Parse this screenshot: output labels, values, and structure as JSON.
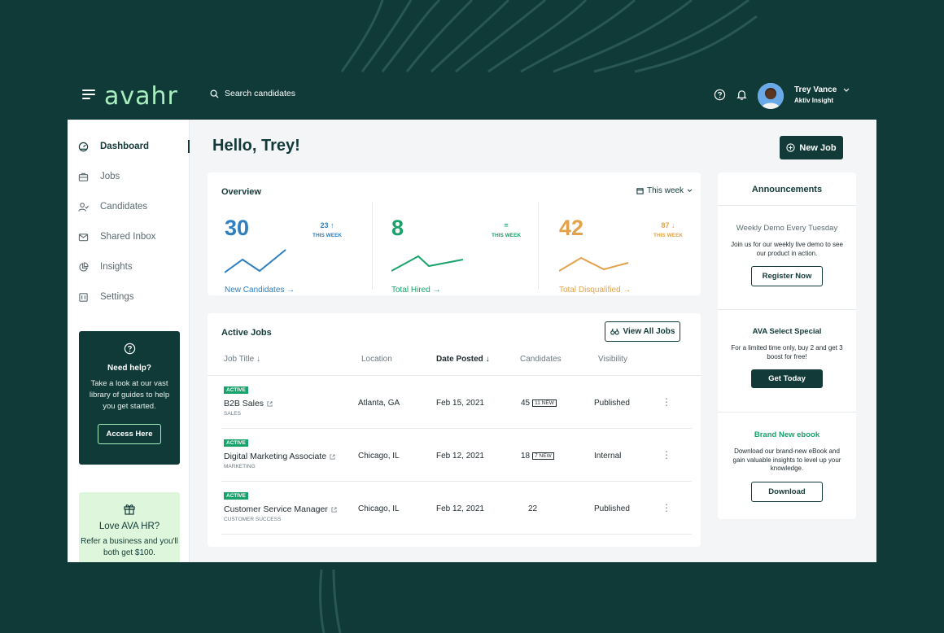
{
  "header": {
    "logo": "avahr",
    "search_placeholder": "Search candidates",
    "user_name": "Trey Vance",
    "user_company": "Aktiv Insight"
  },
  "sidebar": {
    "items": [
      {
        "label": "Dashboard",
        "icon": "gauge-icon",
        "active": true
      },
      {
        "label": "Jobs",
        "icon": "briefcase-icon",
        "active": false
      },
      {
        "label": "Candidates",
        "icon": "user-check-icon",
        "active": false
      },
      {
        "label": "Shared Inbox",
        "icon": "mail-icon",
        "active": false
      },
      {
        "label": "Insights",
        "icon": "pie-chart-icon",
        "active": false
      },
      {
        "label": "Settings",
        "icon": "settings-icon",
        "active": false
      }
    ],
    "help": {
      "title": "Need help?",
      "text": "Take a look at our vast library of guides to help you get started.",
      "button": "Access Here"
    },
    "love": {
      "title": "Love AVA HR?",
      "text": "Refer a business and you'll both get $100."
    }
  },
  "main": {
    "greeting": "Hello, Trey!",
    "new_job": "New Job"
  },
  "overview": {
    "title": "Overview",
    "filter": "This week",
    "stats": [
      {
        "value": "30",
        "delta": "23 ↑",
        "period": "THIS WEEK",
        "label": "New Candidates →",
        "color": "#2d7fc1"
      },
      {
        "value": "8",
        "delta": "=",
        "period": "THIS WEEK",
        "label": "Total Hired →",
        "color": "#19a36b"
      },
      {
        "value": "42",
        "delta": "87 ↓",
        "period": "THIS WEEK",
        "label": "Total Disqualified →",
        "color": "#e3a24a"
      }
    ]
  },
  "jobs": {
    "title": "Active Jobs",
    "view_all": "View All Jobs",
    "columns": [
      "Job Title ↓",
      "Location",
      "Date Posted ↓",
      "Candidates",
      "Visibility"
    ],
    "rows": [
      {
        "status": "ACTIVE",
        "title": "B2B Sales",
        "dept": "SALES",
        "location": "Atlanta, GA",
        "date": "Feb 15, 2021",
        "candidates": "45",
        "new": "11 NEW",
        "visibility": "Published"
      },
      {
        "status": "ACTIVE",
        "title": "Digital Marketing Associate",
        "dept": "MARKETING",
        "location": "Chicago, IL",
        "date": "Feb 12, 2021",
        "candidates": "18",
        "new": "7 NEW",
        "visibility": "Internal"
      },
      {
        "status": "ACTIVE",
        "title": "Customer Service Manager",
        "dept": "CUSTOMER SUCCESS",
        "location": "Chicago, IL",
        "date": "Feb 12, 2021",
        "candidates": "22",
        "new": "",
        "visibility": "Published"
      }
    ]
  },
  "announcements": {
    "title": "Announcements",
    "items": [
      {
        "heading": "Weekly Demo Every Tuesday",
        "text": "Join us for our weekly live demo to see our product in action.",
        "button": "Register Now",
        "heading_color": "#5c6b70"
      },
      {
        "heading": "AVA Select Special",
        "text": "For a limited time only, buy 2 and get 3 boost for free!",
        "button": "Get Today",
        "heading_color": "#123a38"
      },
      {
        "heading": "Brand New ebook",
        "text": "Download our brand-new eBook and gain valuable insights to level up your knowledge.",
        "button": "Download",
        "heading_color": "#19a36b"
      }
    ]
  },
  "colors": {
    "background": "#0f3a38",
    "brand": "#a8efc0",
    "primary": "#123a38",
    "blue": "#2d7fc1",
    "green": "#19a36b",
    "orange": "#e3a24a"
  }
}
